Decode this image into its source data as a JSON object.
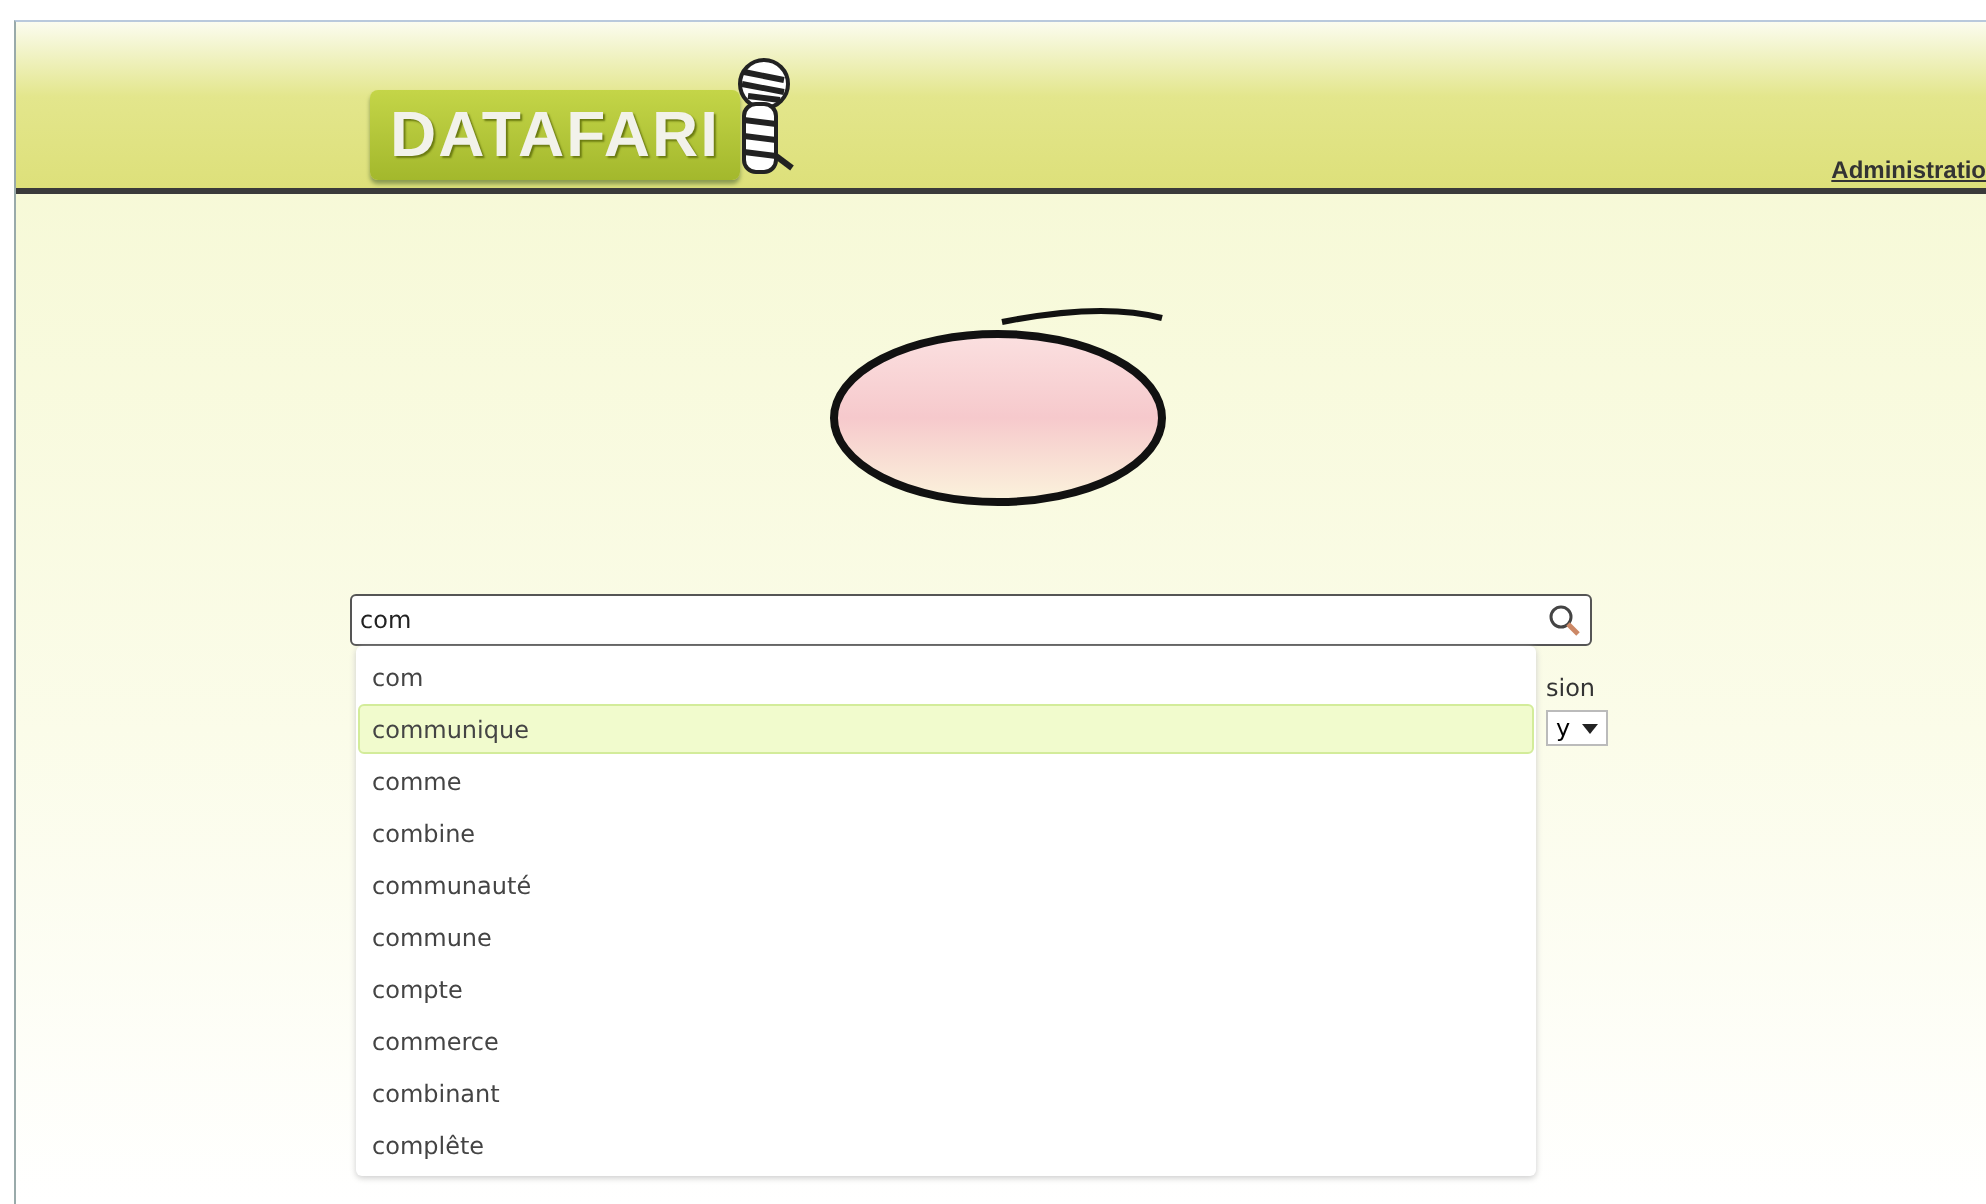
{
  "header": {
    "logo": "DATAFARI",
    "nav_link": "Administratio"
  },
  "search": {
    "value": "com"
  },
  "suggestions": [
    {
      "text": "com",
      "selected": false
    },
    {
      "text": "communique",
      "selected": true
    },
    {
      "text": "comme",
      "selected": false
    },
    {
      "text": "combine",
      "selected": false
    },
    {
      "text": "communauté",
      "selected": false
    },
    {
      "text": "commune",
      "selected": false
    },
    {
      "text": "compte",
      "selected": false
    },
    {
      "text": "commerce",
      "selected": false
    },
    {
      "text": "combinant",
      "selected": false
    },
    {
      "text": "complête",
      "selected": false
    }
  ],
  "hidden_option": {
    "label": "sion",
    "value": "y"
  }
}
